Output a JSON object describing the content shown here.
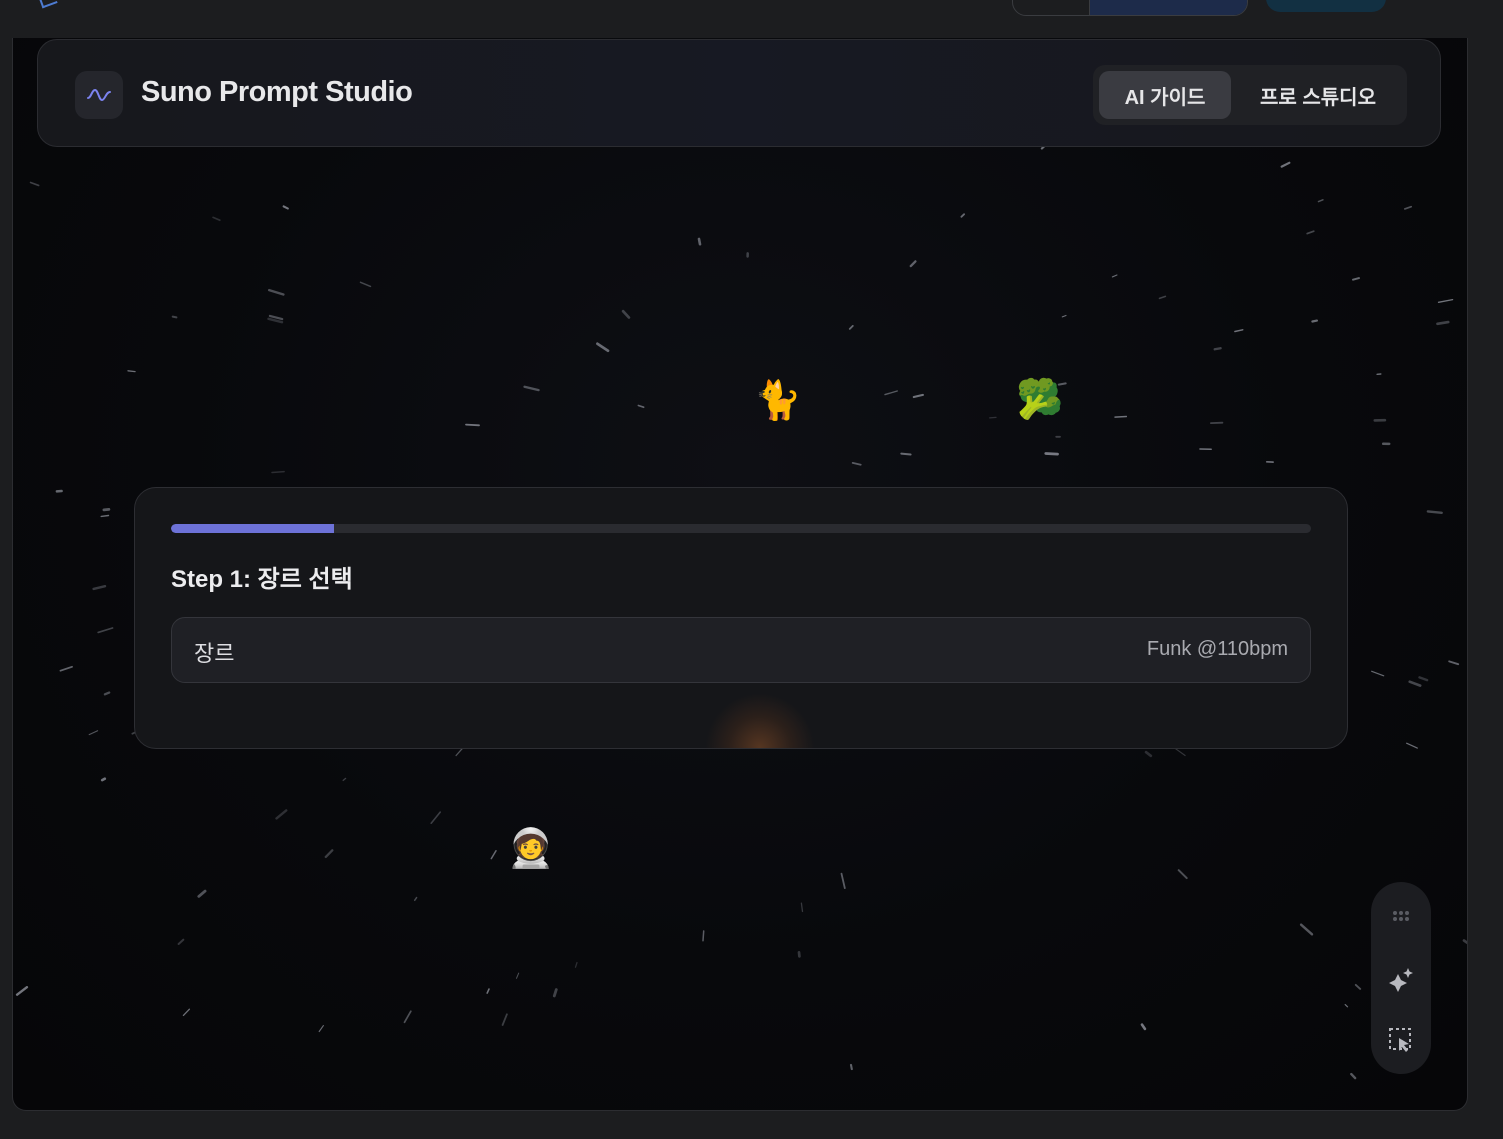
{
  "header": {
    "app_title": "Suno Prompt Studio",
    "logo_icon": "waveform-icon",
    "modes": [
      {
        "label": "AI 가이드",
        "active": true
      },
      {
        "label": "프로 스튜디오",
        "active": false
      }
    ]
  },
  "wizard": {
    "progress_fraction": 0.143,
    "step_title": "Step 1: 장르 선택",
    "field": {
      "label": "장르",
      "value": "Funk @110bpm"
    }
  },
  "decorations": {
    "floating_emojis": [
      {
        "name": "cat-emoji",
        "glyph": "🐈"
      },
      {
        "name": "broccoli-emoji",
        "glyph": "🥦"
      },
      {
        "name": "astronaut-emoji",
        "glyph": "🧑‍🚀"
      }
    ]
  },
  "dock": {
    "items": [
      {
        "name": "drag-handle-icon"
      },
      {
        "name": "sparkle-icon"
      },
      {
        "name": "select-cursor-icon"
      }
    ]
  },
  "colors": {
    "accent": "#6d72d8",
    "background": "#08090c",
    "card": "#151619"
  }
}
